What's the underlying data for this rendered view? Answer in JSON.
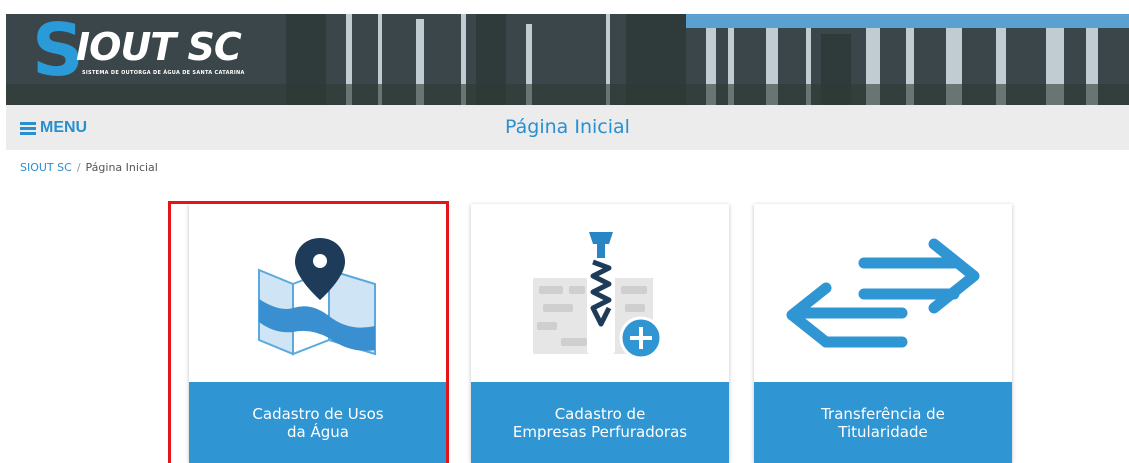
{
  "banner": {
    "logo_letter": "S",
    "logo_text": "IOUT SC",
    "logo_subtitle": "SISTEMA DE OUTORGA DE ÁGUA DE SANTA CATARINA"
  },
  "header": {
    "menu_label": "MENU",
    "page_title": "Página Inicial"
  },
  "breadcrumb": {
    "home": "SIOUT SC",
    "separator": "/",
    "current": "Página Inicial"
  },
  "cards": [
    {
      "label": "Cadastro de Usos\nda Água",
      "icon": "map-pin-icon"
    },
    {
      "label": "Cadastro de\nEmpresas Perfuradoras",
      "icon": "drill-plus-icon"
    },
    {
      "label": "Transferência de\nTitularidade",
      "icon": "transfer-arrows-icon"
    }
  ],
  "colors": {
    "accent": "#2f95d3",
    "highlight_border": "#e4141b",
    "header_bg": "#ececec"
  }
}
